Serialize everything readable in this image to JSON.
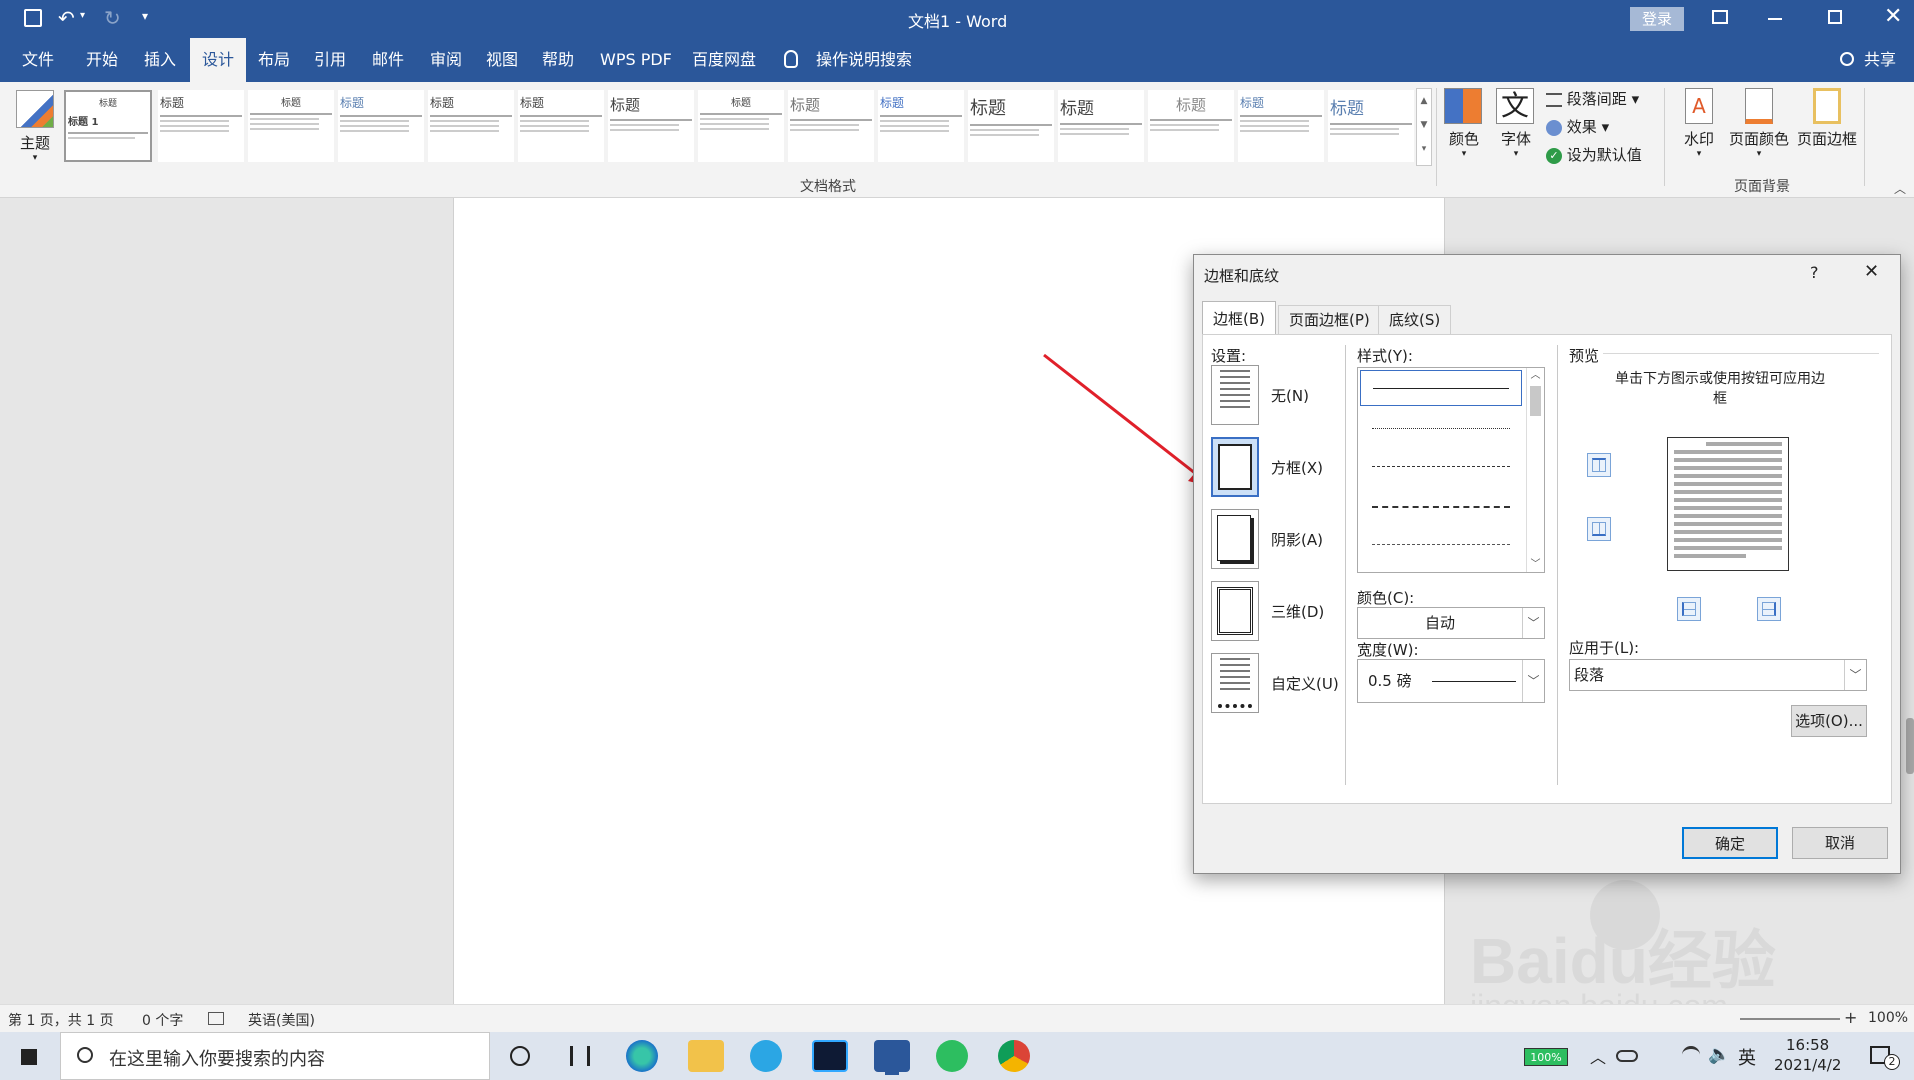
{
  "window": {
    "title": "文档1  -  Word",
    "login_label": "登录"
  },
  "menu": {
    "items": [
      "文件",
      "开始",
      "插入",
      "设计",
      "布局",
      "引用",
      "邮件",
      "审阅",
      "视图",
      "帮助",
      "WPS PDF",
      "百度网盘"
    ],
    "active": "设计",
    "search": "操作说明搜索",
    "share": "共享"
  },
  "ribbon": {
    "theme_label": "主题",
    "gallery_group_label": "文档格式",
    "thumb_titles": [
      "标题",
      "标题",
      "标题",
      "标题",
      "标题",
      "标题",
      "标题",
      "标题",
      "标题",
      "标题",
      "标题",
      "标题",
      "标题",
      "标题",
      "标题",
      "标题"
    ],
    "first_thumb_sub": "标题 1",
    "colors_label": "颜色",
    "fonts_label": "字体",
    "paragraph_spacing_label": "段落间距",
    "effects_label": "效果",
    "set_default_label": "设为默认值",
    "watermark_label": "水印",
    "page_color_label": "页面颜色",
    "page_borders_label": "页面边框",
    "page_bg_group_label": "页面背景",
    "font_glyph": "文"
  },
  "status": {
    "page": "第 1 页，共 1 页",
    "words": "0 个字",
    "language": "英语(美国)",
    "zoom": "100%"
  },
  "taskbar": {
    "search_placeholder": "在这里输入你要搜索的内容",
    "battery": "100%",
    "ime": "英",
    "time": "16:58",
    "date": "2021/4/2",
    "notif_count": "2"
  },
  "dialog": {
    "title": "边框和底纹",
    "help": "?",
    "close": "✕",
    "tabs": [
      "边框(B)",
      "页面边框(P)",
      "底纹(S)"
    ],
    "active_tab": "边框(B)",
    "settings_label": "设置:",
    "settings": [
      "无(N)",
      "方框(X)",
      "阴影(A)",
      "三维(D)",
      "自定义(U)"
    ],
    "selected_setting": "方框(X)",
    "style_label": "样式(Y):",
    "color_label": "颜色(C):",
    "color_value": "自动",
    "width_label": "宽度(W):",
    "width_value": "0.5 磅",
    "preview_label": "预览",
    "preview_hint": "单击下方图示或使用按钮可应用边框",
    "apply_label": "应用于(L):",
    "apply_value": "段落",
    "options_button": "选项(O)...",
    "ok_button": "确定",
    "cancel_button": "取消"
  },
  "watermark": {
    "brand": "Baidu经验",
    "url": "jingyan.baidu.com"
  },
  "colors": {
    "accent": "#2b579a",
    "arrow": "#e0202a",
    "selection": "#3a6fc4"
  }
}
